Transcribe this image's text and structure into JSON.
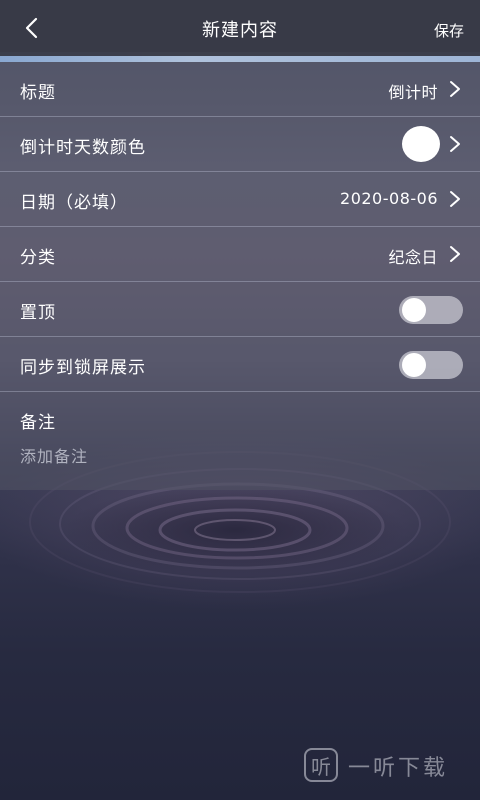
{
  "header": {
    "title": "新建内容",
    "save_label": "保存"
  },
  "form": {
    "rows": [
      {
        "label": "标题",
        "value": "倒计时"
      },
      {
        "label": "倒计时天数颜色",
        "value": "",
        "swatch_color": "#ffffff"
      },
      {
        "label": "日期（必填）",
        "value": "2020-08-06"
      },
      {
        "label": "分类",
        "value": "纪念日"
      },
      {
        "label": "置顶",
        "toggle_on": false
      },
      {
        "label": "同步到锁屏展示",
        "toggle_on": false
      }
    ],
    "notes": {
      "label": "备注",
      "placeholder": "添加备注"
    }
  },
  "watermark": {
    "icon": "听",
    "text": "一听下载"
  },
  "icons": {
    "back": "chevron-left-icon",
    "row_arrow": "chevron-right-icon"
  }
}
